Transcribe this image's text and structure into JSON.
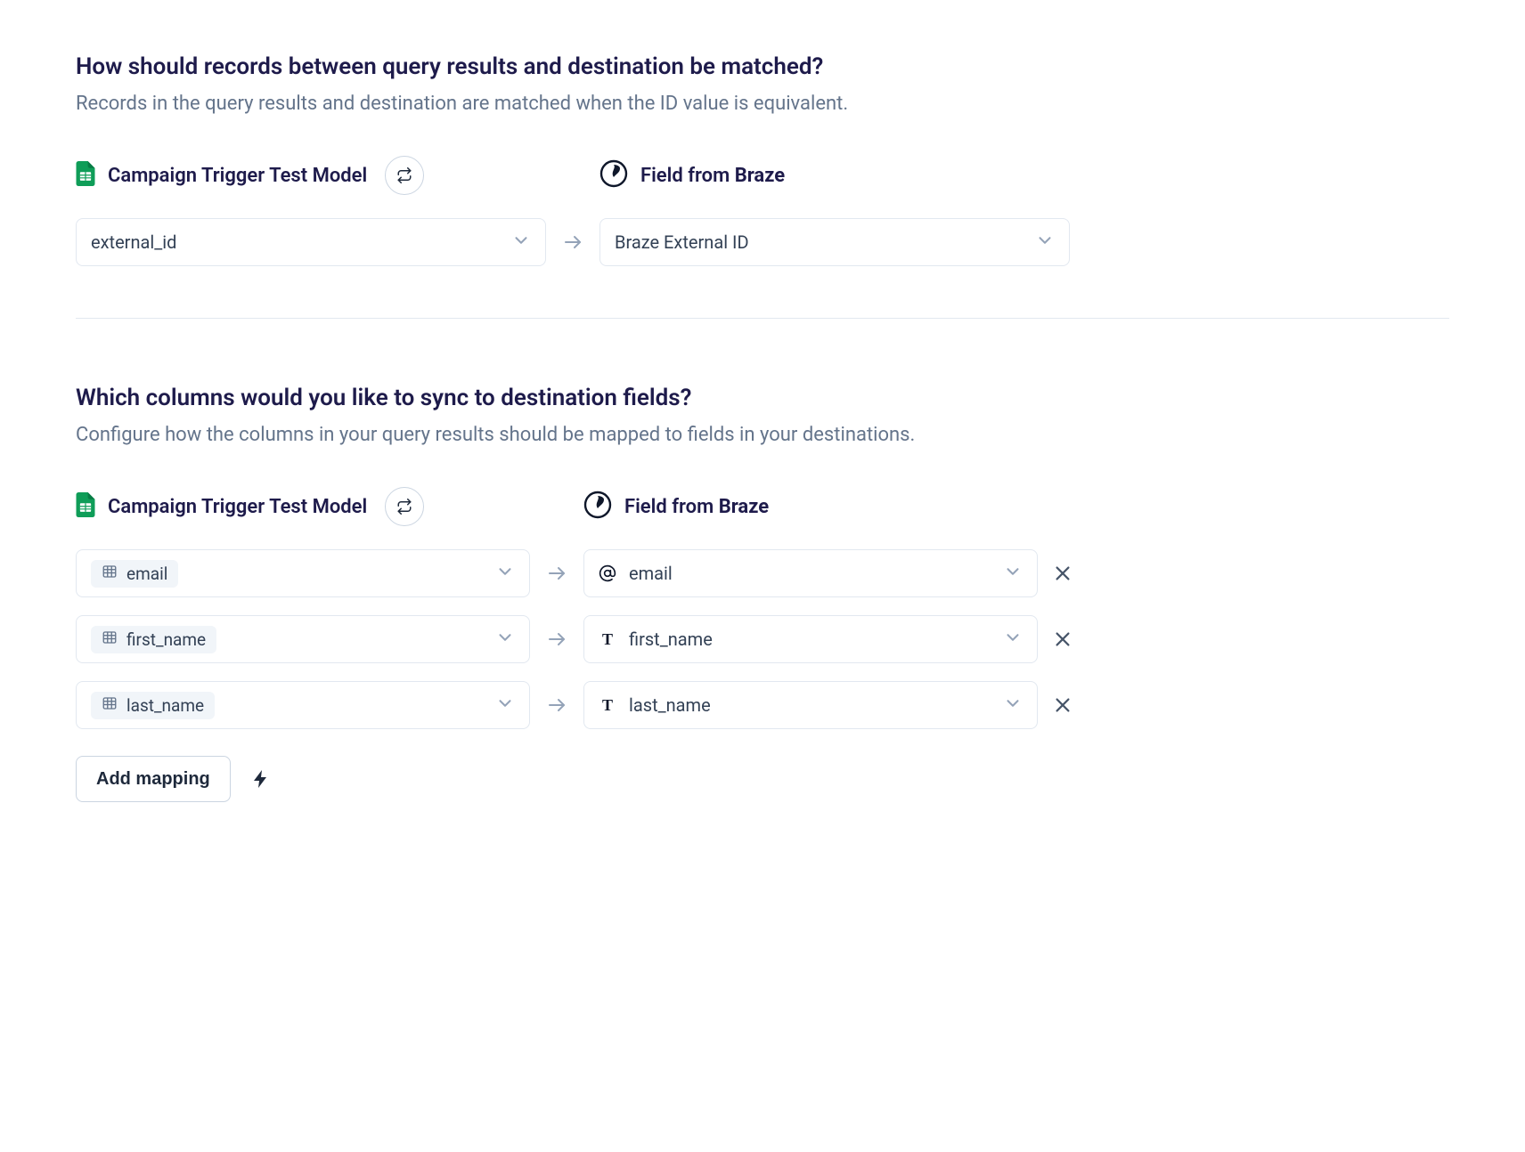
{
  "match_section": {
    "title": "How should records between query results and destination be matched?",
    "description": "Records in the query results and destination are matched when the ID value is equivalent.",
    "source_label": "Campaign Trigger Test Model",
    "dest_label_prefix": "Field from ",
    "dest_label_bold": "Braze",
    "source_value": "external_id",
    "dest_value": "Braze External ID"
  },
  "sync_section": {
    "title": "Which columns would you like to sync to destination fields?",
    "description": "Configure how the columns in your query results should be mapped to fields in your destinations.",
    "source_label": "Campaign Trigger Test Model",
    "dest_label_prefix": "Field from ",
    "dest_label_bold": "Braze",
    "mappings": [
      {
        "source": "email",
        "dest": "email",
        "dest_icon": "at"
      },
      {
        "source": "first_name",
        "dest": "first_name",
        "dest_icon": "text"
      },
      {
        "source": "last_name",
        "dest": "last_name",
        "dest_icon": "text"
      }
    ],
    "add_button": "Add mapping"
  }
}
